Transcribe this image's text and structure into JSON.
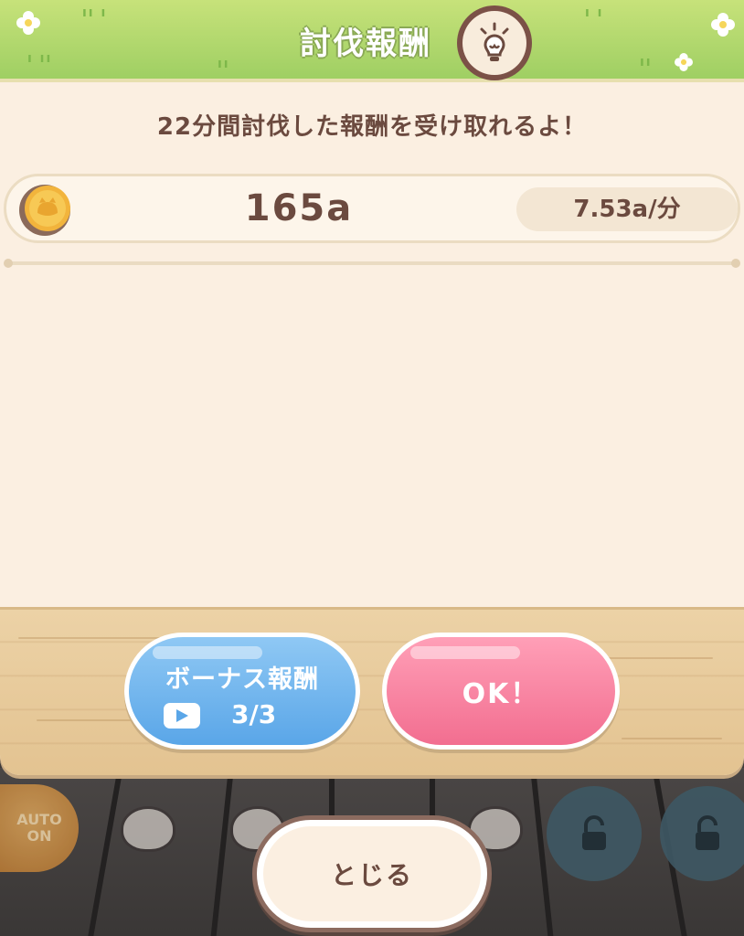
{
  "dialog": {
    "title": "討伐報酬",
    "message": "22分間討伐した報酬を受け取れるよ！",
    "reward": {
      "amount": "165a",
      "rate": "7.53a/分",
      "icon": "coin-icon"
    }
  },
  "buttons": {
    "bonus_label": "ボーナス報酬",
    "bonus_count": "3/3",
    "ok_label": "OK！",
    "close_label": "とじる"
  },
  "background": {
    "auto_label_1": "AUTO",
    "auto_label_2": "ON"
  },
  "colors": {
    "header_green": "#9fcf63",
    "panel_cream": "#fbefe1",
    "text_brown": "#6b4a3f",
    "bonus_blue": "#5aa6e8",
    "ok_pink": "#f26e90",
    "wood": "#e3c391"
  }
}
